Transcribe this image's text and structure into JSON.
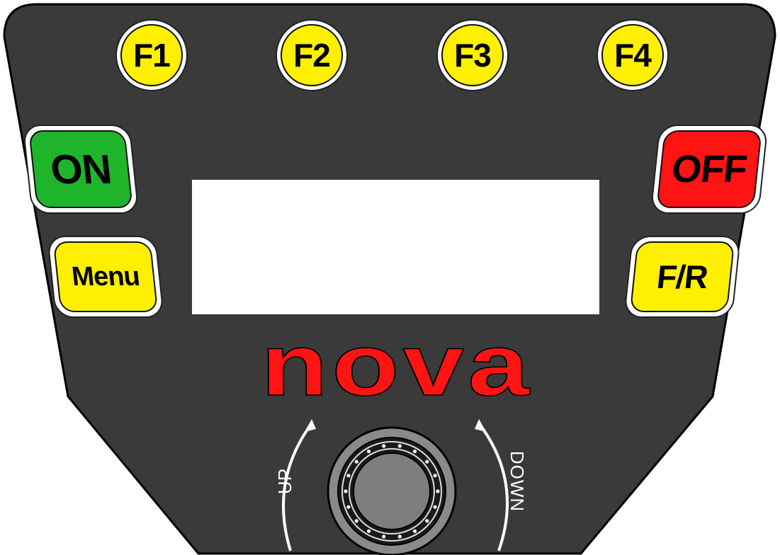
{
  "colors": {
    "panel": "#3a3a3a",
    "yellow": "#ffef00",
    "green": "#1fb52a",
    "red": "#ff1414",
    "white": "#ffffff"
  },
  "function_keys": [
    {
      "label": "F1"
    },
    {
      "label": "F2"
    },
    {
      "label": "F3"
    },
    {
      "label": "F4"
    }
  ],
  "buttons": {
    "on_label": "ON",
    "off_label": "OFF",
    "menu_label": "Menu",
    "fr_label": "F/R"
  },
  "display": {
    "text": ""
  },
  "brand": {
    "logo": "nova"
  },
  "knob": {
    "up_label": "UP",
    "down_label": "DOWN",
    "icon": "rotary-knob-icon"
  }
}
